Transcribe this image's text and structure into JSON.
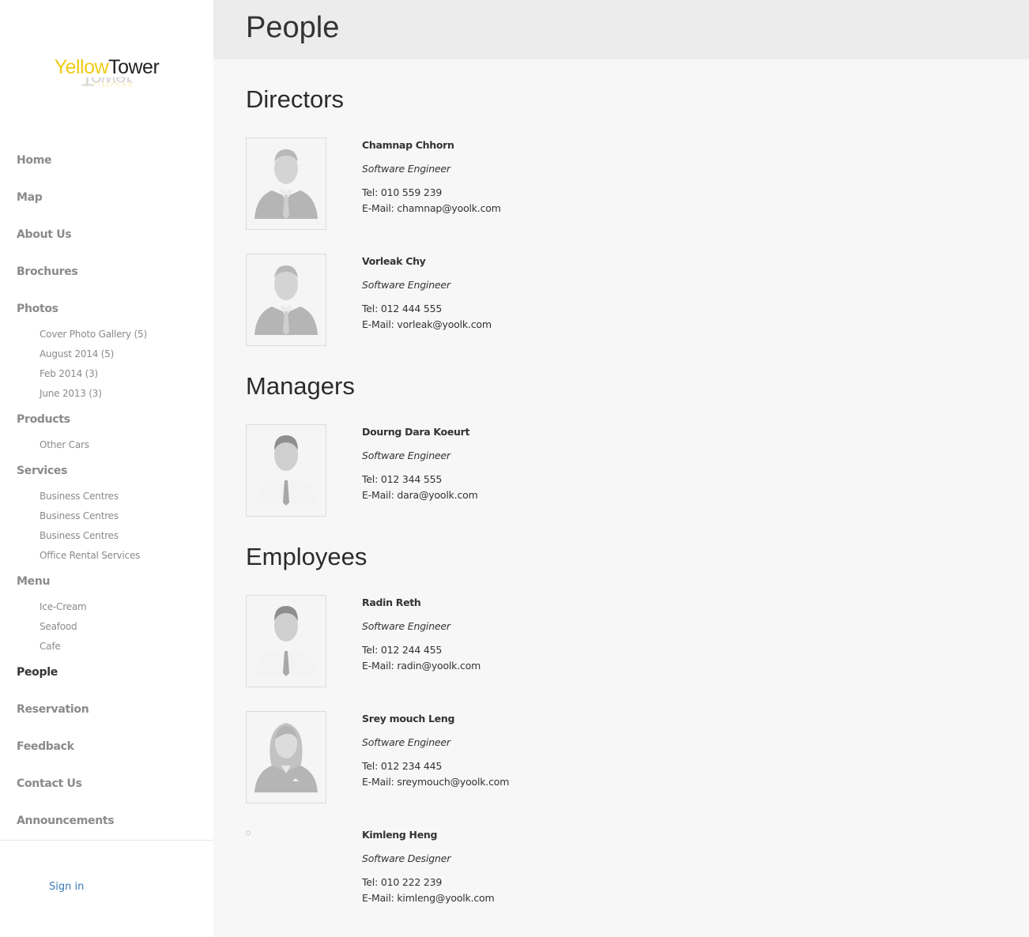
{
  "logo": {
    "part1": "Yellow",
    "part2": "Tower"
  },
  "nav": {
    "home": "Home",
    "map": "Map",
    "about": "About Us",
    "brochures": "Brochures",
    "photos": "Photos",
    "photos_sub": [
      "Cover Photo Gallery (5)",
      "August 2014 (5)",
      "Feb 2014 (3)",
      "June 2013 (3)"
    ],
    "products": "Products",
    "products_sub": [
      "Other Cars"
    ],
    "services": "Services",
    "services_sub": [
      "Business Centres",
      "Business Centres",
      "Business Centres",
      "Office Rental Services"
    ],
    "menu": "Menu",
    "menu_sub": [
      "Ice-Cream",
      "Seafood",
      "Cafe"
    ],
    "people": "People",
    "reservation": "Reservation",
    "feedback": "Feedback",
    "contact": "Contact Us",
    "announcements": "Announcements",
    "signin": "Sign in"
  },
  "page": {
    "title": "People"
  },
  "sections": {
    "directors": {
      "title": "Directors",
      "people": [
        {
          "name": "Chamnap Chhorn",
          "role": "Software Engineer",
          "tel": "Tel: 010 559 239",
          "email": "E-Mail: chamnap@yoolk.com",
          "avatar": "male-suit-avatar-icon"
        },
        {
          "name": "Vorleak Chy",
          "role": "Software Engineer",
          "tel": "Tel: 012 444 555",
          "email": "E-Mail: vorleak@yoolk.com",
          "avatar": "male-suit-avatar-icon"
        }
      ]
    },
    "managers": {
      "title": "Managers",
      "people": [
        {
          "name": "Dourng Dara Koeurt",
          "role": "Software Engineer",
          "tel": "Tel: 012 344 555",
          "email": "E-Mail: dara@yoolk.com",
          "avatar": "male-shirt-avatar-icon"
        }
      ]
    },
    "employees": {
      "title": "Employees",
      "people": [
        {
          "name": "Radin Reth",
          "role": "Software Engineer",
          "tel": "Tel: 012 244 455",
          "email": "E-Mail: radin@yoolk.com",
          "avatar": "male-shirt-avatar-icon"
        },
        {
          "name": "Srey mouch Leng",
          "role": "Software Engineer",
          "tel": "Tel: 012 234 445",
          "email": "E-Mail: sreymouch@yoolk.com",
          "avatar": "female-avatar-icon"
        },
        {
          "name": "Kimleng Heng",
          "role": "Software Designer",
          "tel": "Tel: 010 222 239",
          "email": "E-Mail: kimleng@yoolk.com",
          "avatar": "broken-image-icon"
        }
      ]
    }
  }
}
